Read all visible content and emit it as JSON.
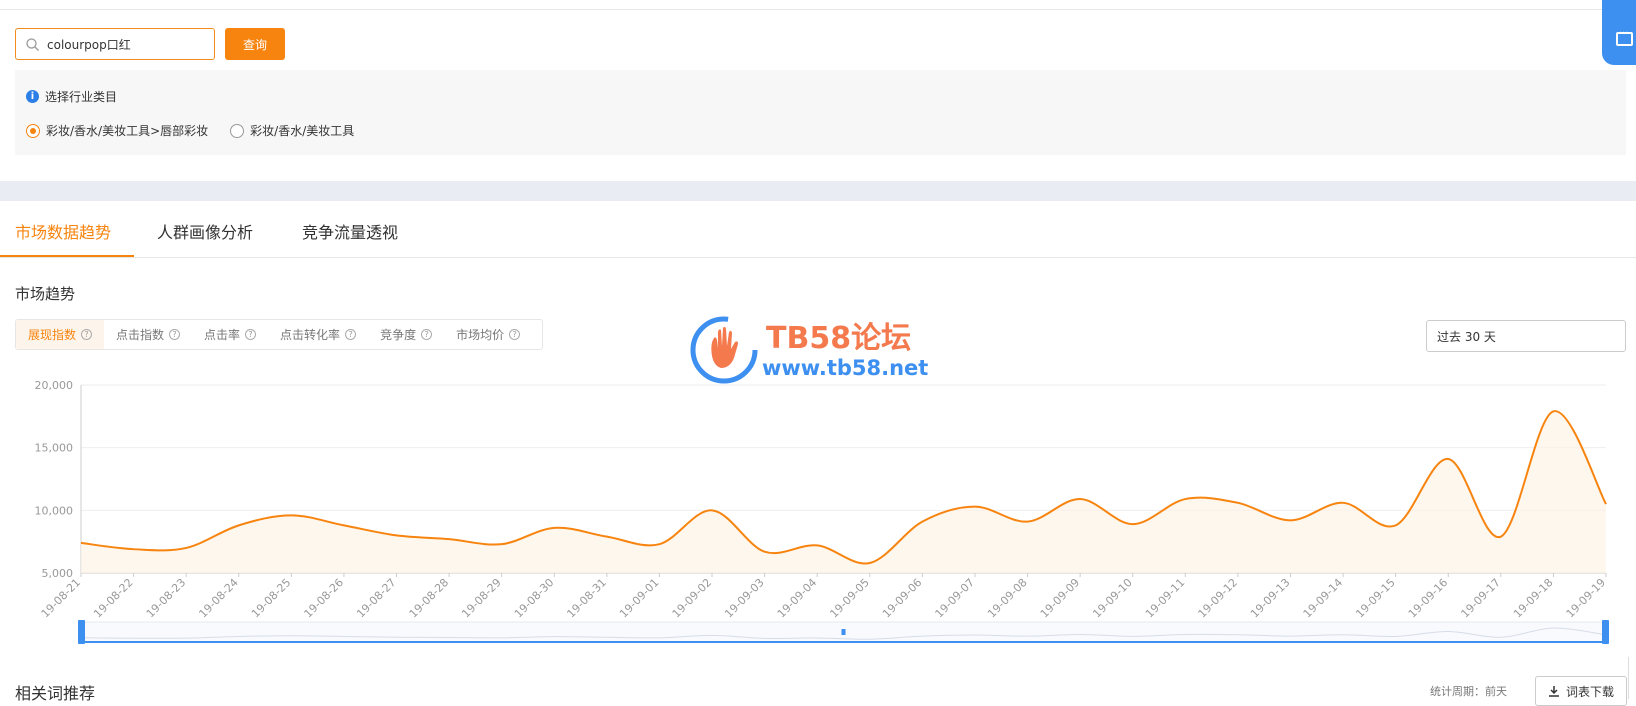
{
  "search": {
    "value": "colourpop口红",
    "button_label": "查询"
  },
  "category": {
    "title": "选择行业类目",
    "info_icon": "i",
    "options": [
      {
        "label": "彩妆/香水/美妆工具>唇部彩妆",
        "checked": true
      },
      {
        "label": "彩妆/香水/美妆工具",
        "checked": false
      }
    ]
  },
  "tabs": [
    {
      "label": "市场数据趋势",
      "active": true
    },
    {
      "label": "人群画像分析",
      "active": false
    },
    {
      "label": "竞争流量透视",
      "active": false
    }
  ],
  "section_title": "市场趋势",
  "metric_tabs": [
    {
      "label": "展现指数",
      "active": true
    },
    {
      "label": "点击指数",
      "active": false
    },
    {
      "label": "点击率",
      "active": false
    },
    {
      "label": "点击转化率",
      "active": false
    },
    {
      "label": "竞争度",
      "active": false
    },
    {
      "label": "市场均价",
      "active": false
    }
  ],
  "qmark_symbol": "?",
  "period_select": "过去 30 天",
  "watermark": {
    "title": "TB58论坛",
    "url": "www.tb58.net"
  },
  "colors": {
    "accent": "#f7840f",
    "blue": "#3d8ff0"
  },
  "chart_data": {
    "type": "area",
    "x": [
      "19-08-21",
      "19-08-22",
      "19-08-23",
      "19-08-24",
      "19-08-25",
      "19-08-26",
      "19-08-27",
      "19-08-28",
      "19-08-29",
      "19-08-30",
      "19-08-31",
      "19-09-01",
      "19-09-02",
      "19-09-03",
      "19-09-04",
      "19-09-05",
      "19-09-06",
      "19-09-07",
      "19-09-08",
      "19-09-09",
      "19-09-10",
      "19-09-11",
      "19-09-12",
      "19-09-13",
      "19-09-14",
      "19-09-15",
      "19-09-16",
      "19-09-17",
      "19-09-18",
      "19-09-19"
    ],
    "values": [
      7400,
      6900,
      7000,
      8800,
      9600,
      8800,
      8000,
      7700,
      7300,
      8600,
      7900,
      7300,
      10000,
      6700,
      7200,
      5800,
      9100,
      10300,
      9100,
      10900,
      8900,
      10900,
      10600,
      9200,
      10600,
      8800,
      14100,
      7900,
      17900,
      10500
    ],
    "ylim": [
      5000,
      20000
    ],
    "yticks": [
      "20,000",
      "15,000",
      "10,000",
      "5,000"
    ],
    "ytick_values": [
      20000,
      15000,
      10000,
      5000
    ],
    "grid": true
  },
  "bottom": {
    "title": "相关词推荐",
    "meta": "统计周期：前天",
    "download_label": "词表下载"
  }
}
